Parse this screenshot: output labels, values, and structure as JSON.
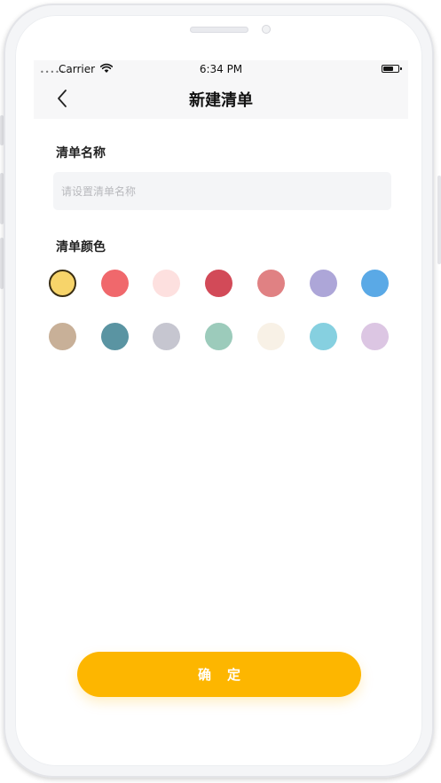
{
  "status_bar": {
    "signal": "•••••",
    "carrier": "Carrier",
    "time": "6:34 PM"
  },
  "nav": {
    "title": "新建清单",
    "back_icon": "chevron-left-icon"
  },
  "form": {
    "name_label": "清单名称",
    "name_input": {
      "value": "",
      "placeholder": "请设置清单名称"
    },
    "color_label": "清单颜色",
    "selected_color": "#f7d46a",
    "colors": [
      [
        "#f7d46a",
        "#f0686c",
        "#fde0df",
        "#d24a58",
        "#e08183",
        "#ada6d8",
        "#5aa9e6"
      ],
      [
        "#c8b098",
        "#5a94a2",
        "#c6c6d0",
        "#9ccbbb",
        "#f8f1e6",
        "#86d0e0",
        "#dcc6e3"
      ]
    ]
  },
  "confirm_label": "确定",
  "theme": {
    "accent": "#fdb600"
  }
}
